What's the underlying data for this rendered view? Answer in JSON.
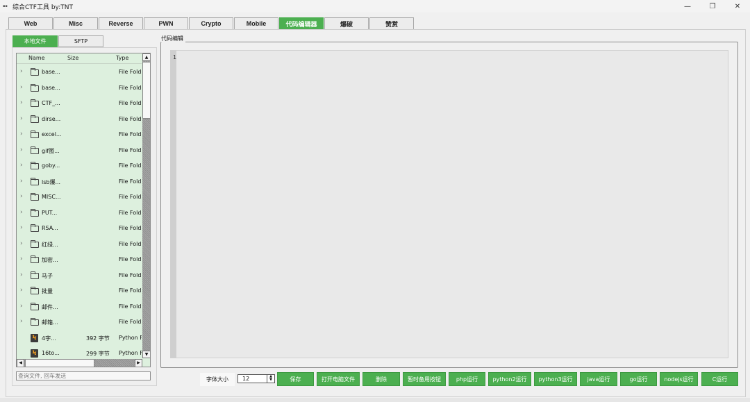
{
  "window": {
    "title": "综合CTF工具   by:TNT",
    "minimize_glyph": "—",
    "restore_glyph": "❐",
    "close_glyph": "✕"
  },
  "main_tabs": [
    {
      "label": "Web",
      "active": false
    },
    {
      "label": "Misc",
      "active": false
    },
    {
      "label": "Reverse",
      "active": false
    },
    {
      "label": "PWN",
      "active": false
    },
    {
      "label": "Crypto",
      "active": false
    },
    {
      "label": "Mobile",
      "active": false
    },
    {
      "label": "代码编辑器",
      "active": true
    },
    {
      "label": "爆破",
      "active": false
    },
    {
      "label": "赞赏",
      "active": false
    }
  ],
  "sub_tabs": [
    {
      "label": "本地文件",
      "active": true
    },
    {
      "label": "SFTP",
      "active": false
    }
  ],
  "file_tree": {
    "columns": {
      "name": "Name",
      "size": "Size",
      "type": "Type"
    },
    "rows": [
      {
        "kind": "folder",
        "name": "base...",
        "size": "",
        "type": "File Fold"
      },
      {
        "kind": "folder",
        "name": "base...",
        "size": "",
        "type": "File Fold"
      },
      {
        "kind": "folder",
        "name": "CTF_...",
        "size": "",
        "type": "File Fold"
      },
      {
        "kind": "folder",
        "name": "dirse...",
        "size": "",
        "type": "File Fold"
      },
      {
        "kind": "folder",
        "name": "excel...",
        "size": "",
        "type": "File Fold"
      },
      {
        "kind": "folder",
        "name": "gif图...",
        "size": "",
        "type": "File Fold"
      },
      {
        "kind": "folder",
        "name": "goby...",
        "size": "",
        "type": "File Fold"
      },
      {
        "kind": "folder",
        "name": "lsb爆...",
        "size": "",
        "type": "File Fold"
      },
      {
        "kind": "folder",
        "name": "MISC...",
        "size": "",
        "type": "File Fold"
      },
      {
        "kind": "folder",
        "name": "PUT...",
        "size": "",
        "type": "File Fold"
      },
      {
        "kind": "folder",
        "name": "RSA...",
        "size": "",
        "type": "File Fold"
      },
      {
        "kind": "folder",
        "name": "红绿...",
        "size": "",
        "type": "File Fold"
      },
      {
        "kind": "folder",
        "name": "加密...",
        "size": "",
        "type": "File Fold"
      },
      {
        "kind": "folder",
        "name": "马子",
        "size": "",
        "type": "File Fold"
      },
      {
        "kind": "folder",
        "name": "批量",
        "size": "",
        "type": "File Fold"
      },
      {
        "kind": "folder",
        "name": "邮件...",
        "size": "",
        "type": "File Fold"
      },
      {
        "kind": "folder",
        "name": "邮箱...",
        "size": "",
        "type": "File Fold"
      },
      {
        "kind": "file",
        "name": "4字...",
        "size": "392 字节",
        "type": "Python F"
      },
      {
        "kind": "file",
        "name": "16to...",
        "size": "299 字节",
        "type": "Python F"
      }
    ]
  },
  "search": {
    "placeholder": "查询文件, 回车发送",
    "value": ""
  },
  "editor": {
    "group_title": "代码编辑",
    "line_number": "1",
    "content": ""
  },
  "toolbar": {
    "font_size_label": "字体大小",
    "font_size_value": "12",
    "buttons": [
      {
        "label": "保存"
      },
      {
        "label": "打开电脑文件"
      },
      {
        "label": "删除"
      },
      {
        "label": "暂时备用按钮"
      },
      {
        "label": "php运行"
      },
      {
        "label": "python2运行"
      },
      {
        "label": "python3运行"
      },
      {
        "label": "java运行"
      },
      {
        "label": "go运行"
      },
      {
        "label": "nodejs运行"
      },
      {
        "label": "C运行"
      }
    ]
  },
  "colors": {
    "accent": "#4caf50",
    "tree_bg": "#ddf0de",
    "window_bg": "#f0f0f0"
  }
}
